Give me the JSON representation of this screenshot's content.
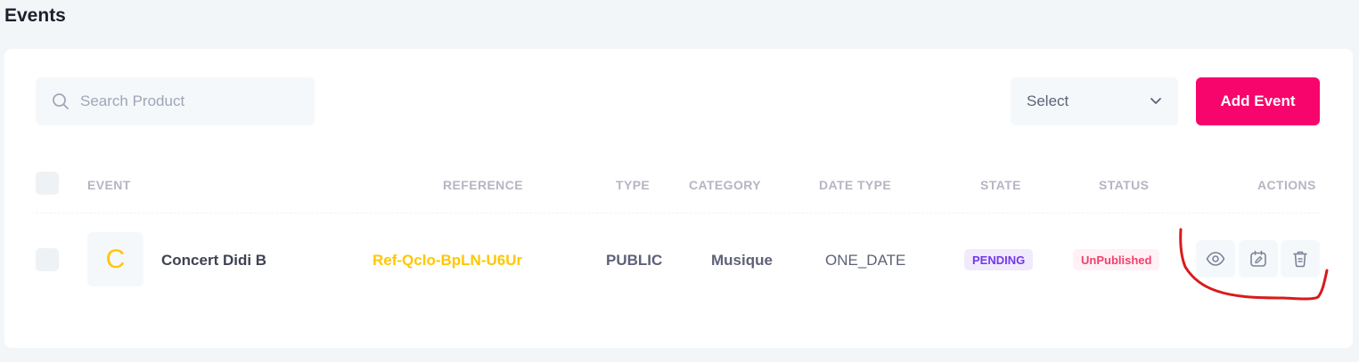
{
  "page": {
    "title": "Events"
  },
  "toolbar": {
    "search_placeholder": "Search Product",
    "select_label": "Select",
    "add_button": "Add Event"
  },
  "table": {
    "columns": [
      "EVENT",
      "REFERENCE",
      "TYPE",
      "CATEGORY",
      "DATE TYPE",
      "STATE",
      "STATUS",
      "ACTIONS"
    ],
    "rows": [
      {
        "avatar_letter": "C",
        "event": "Concert Didi B",
        "reference": "Ref-Qclo-BpLN-U6Ur",
        "type": "PUBLIC",
        "category": "Musique",
        "date_type": "ONE_DATE",
        "state": "PENDING",
        "status": "UnPublished"
      }
    ]
  },
  "icons": {
    "search": "search-icon",
    "select": "chevron-down-icon",
    "view": "eye-icon",
    "edit": "calendar-edit-icon",
    "delete": "trash-icon"
  },
  "colors": {
    "accent": "#f8046d",
    "reference": "#ffc700",
    "pending": "#7239ea",
    "unpublished": "#f1416c",
    "annotation": "#d81b1b"
  }
}
